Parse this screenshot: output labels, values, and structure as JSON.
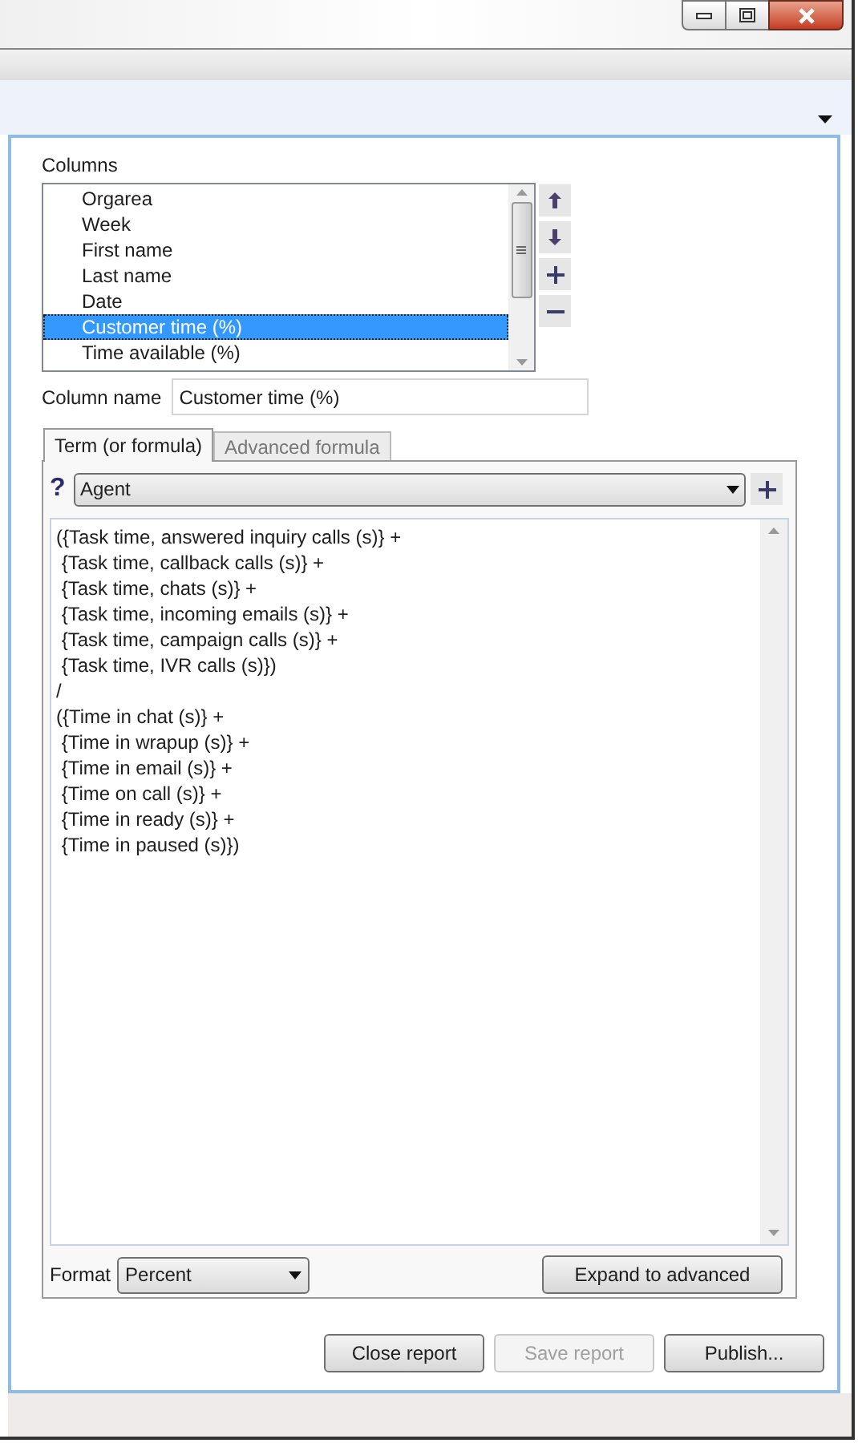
{
  "columns_label": "Columns",
  "columns": [
    {
      "label": "Orgarea",
      "selected": false
    },
    {
      "label": "Week",
      "selected": false
    },
    {
      "label": "First name",
      "selected": false
    },
    {
      "label": "Last name",
      "selected": false
    },
    {
      "label": "Date",
      "selected": false
    },
    {
      "label": "Customer time (%)",
      "selected": true
    },
    {
      "label": "Time available (%)",
      "selected": false
    }
  ],
  "column_name": {
    "label": "Column name",
    "value": "Customer time (%)"
  },
  "tabs": [
    {
      "label": "Term (or formula)",
      "selected": true
    },
    {
      "label": "Advanced formula",
      "selected": false
    }
  ],
  "help": "?",
  "entity_dropdown": {
    "value": "Agent"
  },
  "formula": [
    "({Task time, answered inquiry calls (s)} +",
    " {Task time, callback calls (s)} +",
    " {Task time, chats (s)} +",
    " {Task time, incoming emails (s)} +",
    " {Task time, campaign calls (s)} +",
    " {Task time, IVR calls (s)})",
    "/",
    "({Time in chat (s)} +",
    " {Time in wrapup (s)} +",
    " {Time in email (s)} +",
    " {Time on call (s)} +",
    " {Time in ready (s)} +",
    " {Time in paused (s)})"
  ],
  "format": {
    "label": "Format",
    "value": "Percent"
  },
  "expand_button": "Expand to advanced",
  "buttons": [
    {
      "label": "Close report",
      "disabled": false
    },
    {
      "label": "Save report",
      "disabled": true
    },
    {
      "label": "Publish...",
      "disabled": false
    }
  ]
}
